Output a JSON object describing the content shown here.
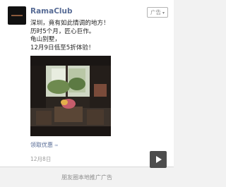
{
  "post": {
    "account_name": "RamaClub",
    "ad_badge": "广告",
    "text_lines": [
      "深圳，竟有如此情调的地方！",
      "历时5个月，匠心巨作。",
      "龟山别墅，",
      "12月9日低至5折体验！"
    ],
    "link_text": "领取优惠",
    "date": "12月8日"
  },
  "footer": {
    "caption": "朋友圈本地推广广告"
  },
  "icons": {
    "avatar": "brand-logo",
    "badge_caret": "chevron-down-icon",
    "link": "link-icon",
    "play": "play-icon"
  },
  "colors": {
    "link_blue": "#576b95",
    "text_dark": "#222222",
    "muted_gray": "#9a9a9a"
  }
}
